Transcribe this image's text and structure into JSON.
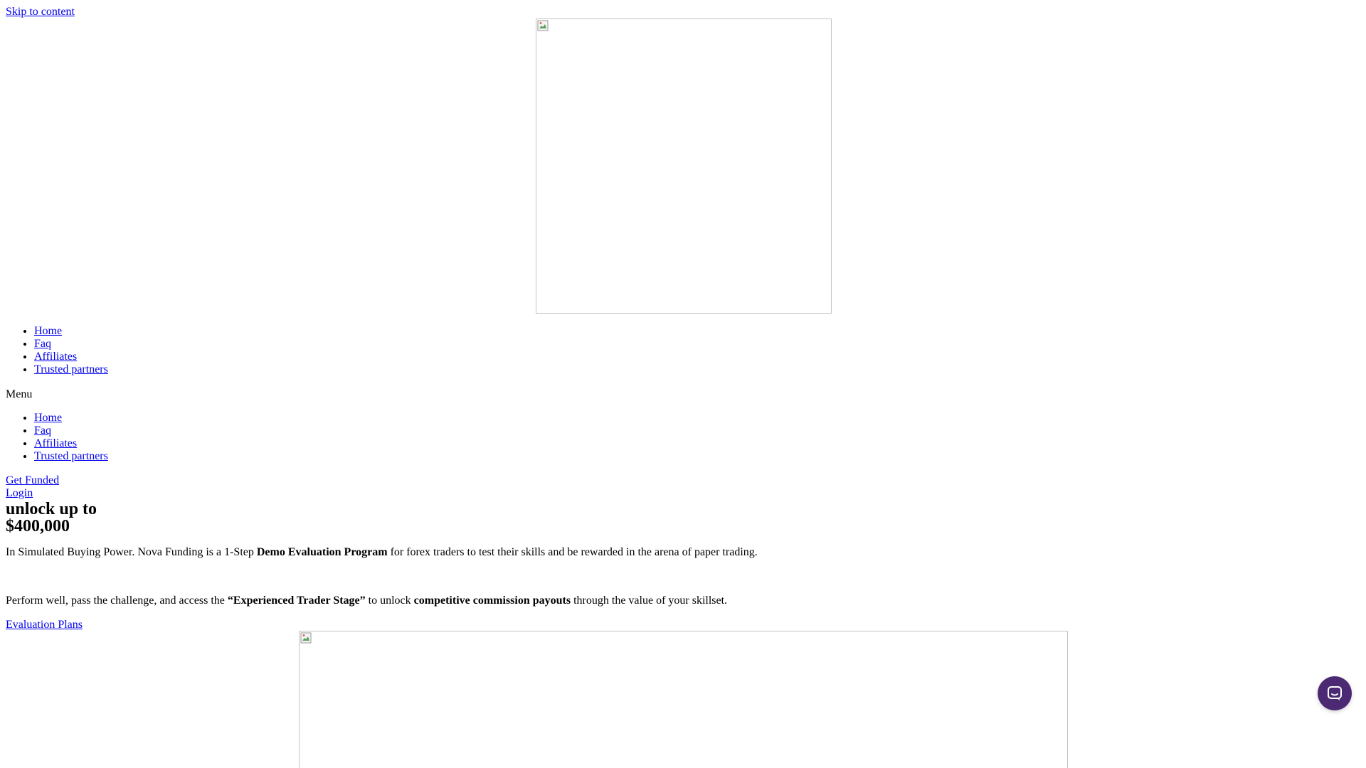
{
  "skip_link": "Skip to content",
  "images": {
    "logo_icon": "broken-image-icon",
    "hero_icon": "broken-image-icon"
  },
  "primary_nav": {
    "items": [
      {
        "label": "Home"
      },
      {
        "label": "Faq"
      },
      {
        "label": "Affiliates"
      },
      {
        "label": "Trusted partners"
      }
    ]
  },
  "mobile_menu": {
    "label": "Menu",
    "items": [
      {
        "label": "Home"
      },
      {
        "label": "Faq"
      },
      {
        "label": "Affiliates"
      },
      {
        "label": "Trusted partners"
      }
    ]
  },
  "header_buttons": {
    "get_funded": "Get Funded",
    "login": "Login"
  },
  "hero": {
    "title_line1": "unlock up to",
    "title_line2": "$400,000",
    "paragraph1": {
      "before": "In Simulated Buying Power. Nova Funding is a 1-Step ",
      "bold": "Demo Evaluation Program",
      "after": " for forex traders to test their skills and be rewarded in the arena of paper trading."
    },
    "paragraph2": {
      "before": "Perform well, pass the challenge, and access the ",
      "bold1": "“Experienced Trader Stage”",
      "middle": " to unlock ",
      "bold2": "competitive commission payouts",
      "after": " through the value of your skillset."
    },
    "cta_link": "Evaluation Plans"
  },
  "chat_widget": {
    "icon": "chat-bubble-icon",
    "color": "#4b2a73"
  },
  "colors": {
    "link": "#0000ee",
    "text": "#000000",
    "background": "#ffffff",
    "image_border": "#c4c4c4"
  }
}
